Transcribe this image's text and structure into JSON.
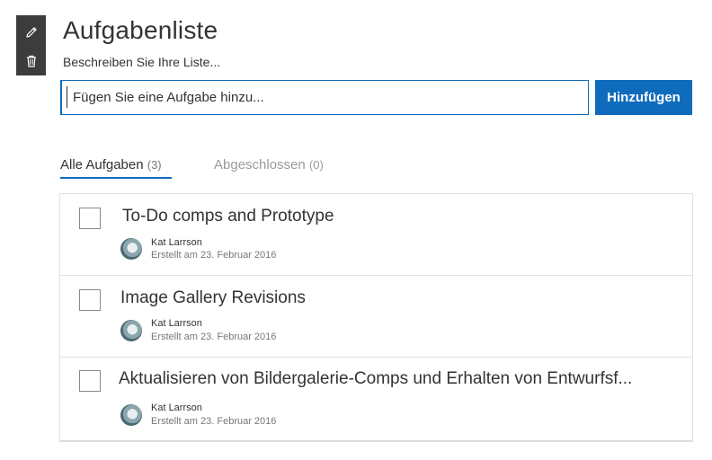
{
  "toolbar": {
    "edit_icon": "pencil-icon",
    "delete_icon": "trash-icon"
  },
  "list": {
    "title": "Aufgabenliste",
    "description_placeholder": "Beschreiben Sie Ihre Liste..."
  },
  "add_task": {
    "placeholder": "Fügen Sie eine Aufgabe hinzu...",
    "button_label": "Hinzufügen"
  },
  "tabs": [
    {
      "label": "Alle Aufgaben",
      "count": "(3)",
      "active": true
    },
    {
      "label": "Abgeschlossen",
      "count": "(0)",
      "active": false
    }
  ],
  "tasks": [
    {
      "title": "To-Do comps and Prototype",
      "author": "Kat Larrson",
      "created": "Erstellt am 23. Februar 2016",
      "completed": false
    },
    {
      "title": "Image Gallery Revisions",
      "author": "Kat Larrson",
      "created": "Erstellt am 23. Februar 2016",
      "completed": false
    },
    {
      "title": "Aktualisieren von Bildergalerie-Comps und Erhalten von Entwurfsf...",
      "author": "Kat Larrson",
      "created": "Erstellt am 23. Februar 2016",
      "completed": false
    }
  ],
  "colors": {
    "accent": "#0f6cbd",
    "toolbar_bg": "#3c3c3c",
    "text": "#333333",
    "muted": "#9a9a9a"
  }
}
